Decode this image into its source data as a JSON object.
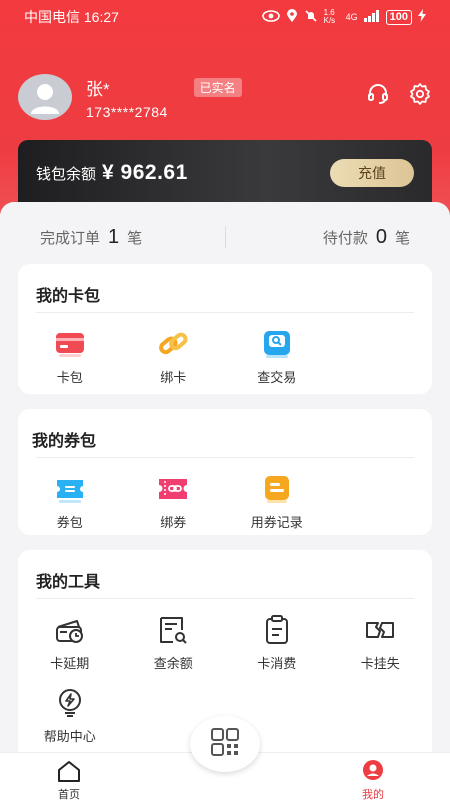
{
  "status": {
    "carrier_time": "中国电信 16:27",
    "network_speed": "1.6 K/s",
    "network_type": "4G",
    "battery": "100"
  },
  "profile": {
    "name": "张*",
    "verified": "已实名",
    "phone": "173****2784"
  },
  "wallet": {
    "label": "钱包余额",
    "amount": "¥ 962.61",
    "recharge": "充值"
  },
  "orders": {
    "completed_label": "完成订单",
    "completed_count": "1",
    "completed_unit": "笔",
    "pending_label": "待付款",
    "pending_count": "0",
    "pending_unit": "笔"
  },
  "card_wallet": {
    "title": "我的卡包",
    "items": [
      {
        "label": "卡包",
        "icon": "card-icon"
      },
      {
        "label": "绑卡",
        "icon": "link-icon"
      },
      {
        "label": "查交易",
        "icon": "search-transaction-icon"
      }
    ]
  },
  "coupon_wallet": {
    "title": "我的券包",
    "items": [
      {
        "label": "券包",
        "icon": "coupon-icon"
      },
      {
        "label": "绑券",
        "icon": "bind-coupon-icon"
      },
      {
        "label": "用券记录",
        "icon": "coupon-record-icon"
      }
    ]
  },
  "tools": {
    "title": "我的工具",
    "items": [
      {
        "label": "卡延期",
        "icon": "card-extend-icon"
      },
      {
        "label": "查余额",
        "icon": "balance-query-icon"
      },
      {
        "label": "卡消费",
        "icon": "card-spend-icon"
      },
      {
        "label": "卡挂失",
        "icon": "card-report-loss-icon"
      },
      {
        "label": "帮助中心",
        "icon": "help-center-icon"
      }
    ]
  },
  "tabbar": {
    "home": "首页",
    "mine": "我的"
  },
  "colors": {
    "brand_red": "#ee3d42",
    "gold": "#e4cf9f"
  }
}
